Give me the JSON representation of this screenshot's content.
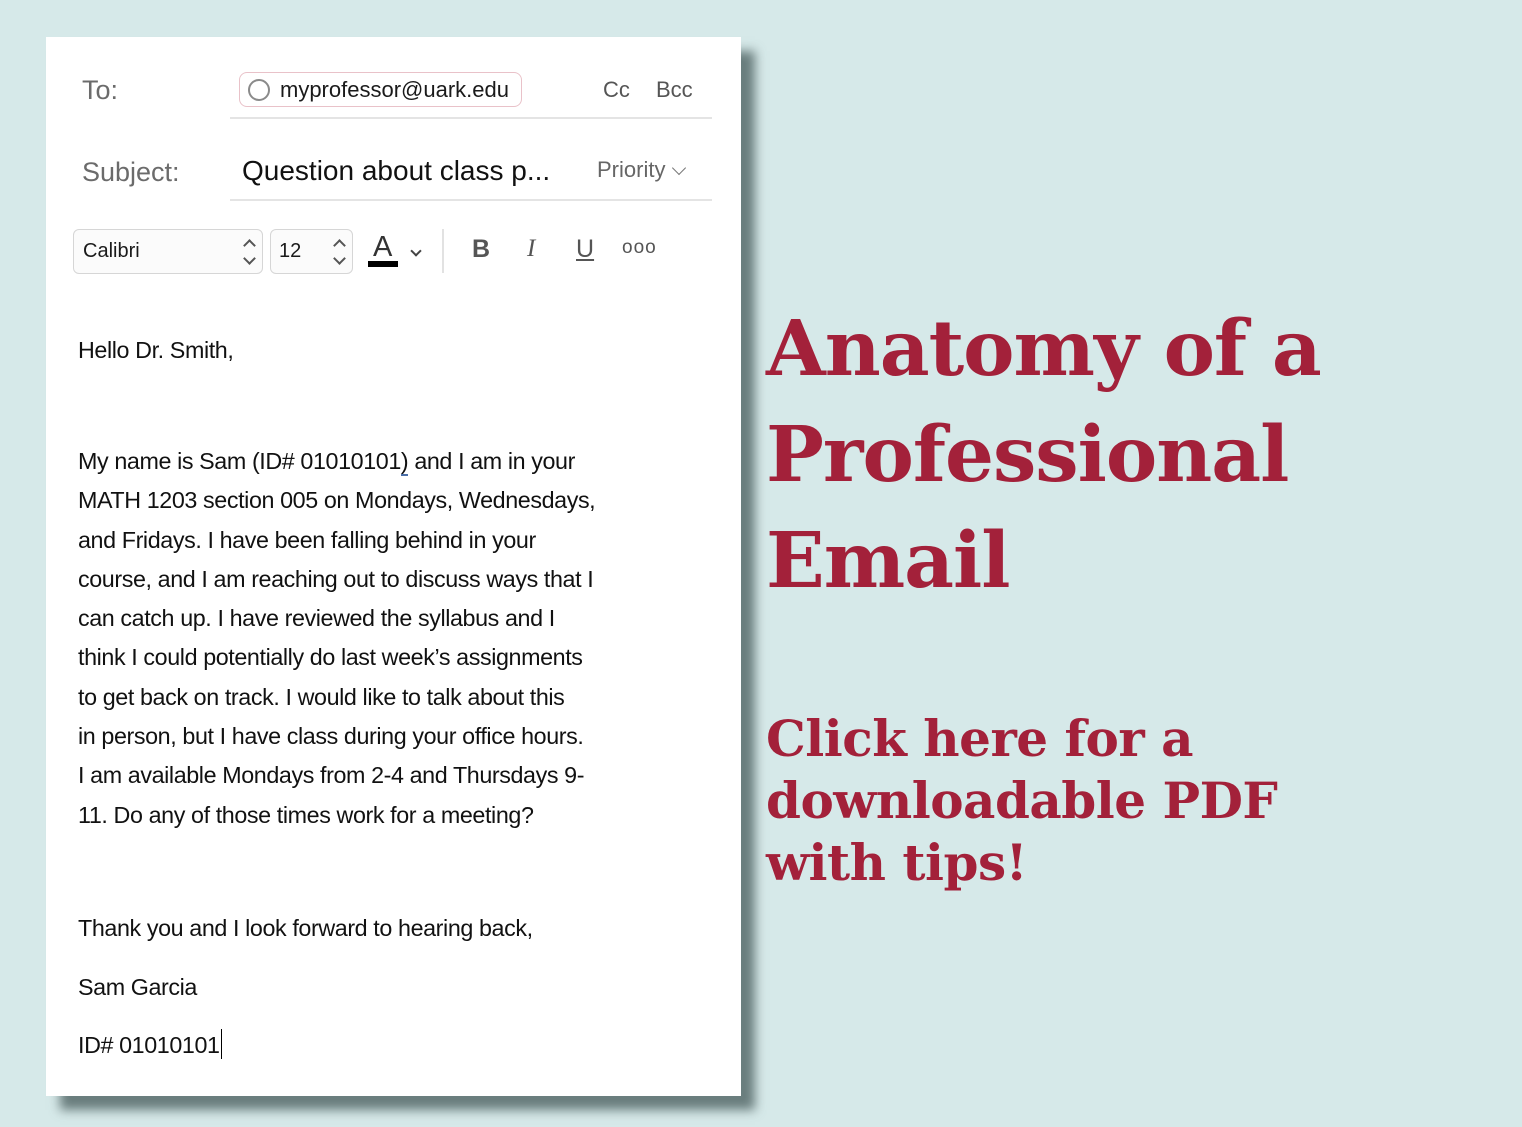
{
  "compose": {
    "to_label": "To:",
    "recipient": "myprofessor@uark.edu",
    "cc_label": "Cc",
    "bcc_label": "Bcc",
    "subject_label": "Subject:",
    "subject_value": "Question about class p...",
    "priority_label": "Priority"
  },
  "toolbar": {
    "font_family": "Calibri",
    "font_size": "12",
    "font_color_letter": "A",
    "font_color": "#000000",
    "bold_label": "B",
    "italic_label": "I",
    "underline_label": "U",
    "more_label": "ooo"
  },
  "body": {
    "greeting": "Hello Dr. Smith,",
    "paragraph_lines": [
      "My name is Sam (ID# 01010101) and I am in your",
      "MATH 1203 section 005 on Mondays, Wednesdays,",
      "and Fridays. I have been falling behind in your",
      "course, and I am reaching out to discuss ways that I",
      "can catch up. I have reviewed the syllabus and I",
      "think I could potentially do last week’s assignments",
      "to get back on track. I would like to talk about this",
      "in person, but I have class during your office hours.",
      "I am available Mondays from 2-4 and Thursdays 9-",
      "11. Do any of those times work for a meeting?"
    ],
    "line0_pre": "My name is Sam (ID# 01010101",
    "line0_mark": ")",
    "line0_post": " and I am in your",
    "closing": "Thank you and I look forward to hearing back,",
    "signature_name": "Sam Garcia",
    "signature_id": "ID# 01010101"
  },
  "headline": {
    "lines": [
      "Anatomy of a",
      "Professional",
      "Email"
    ],
    "color": "#a3213a"
  },
  "cta": {
    "lines": [
      "Click here for a",
      "downloadable PDF",
      "with tips!"
    ]
  },
  "colors": {
    "background": "#d6e9e9",
    "accent": "#a3213a"
  }
}
